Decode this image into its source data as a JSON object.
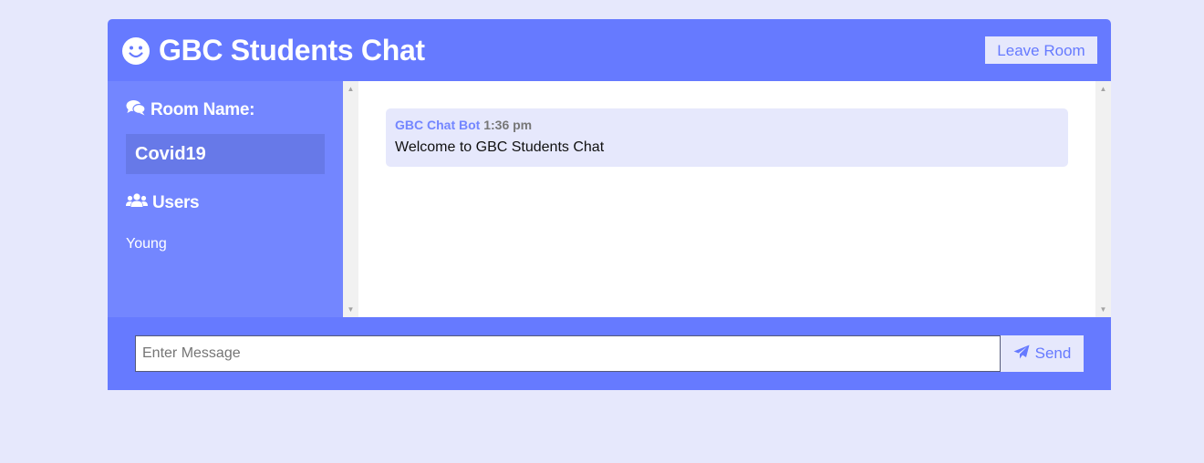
{
  "header": {
    "title": "GBC Students Chat",
    "leave_label": "Leave Room",
    "icon": "smile-icon"
  },
  "sidebar": {
    "room_heading": "Room Name:",
    "room_heading_icon": "comments-icon",
    "room_name": "Covid19",
    "users_heading": "Users",
    "users_heading_icon": "users-icon",
    "users": [
      "Young"
    ]
  },
  "messages": [
    {
      "username": "GBC Chat Bot",
      "time": "1:36 pm",
      "text": "Welcome to GBC Students Chat"
    }
  ],
  "form": {
    "placeholder": "Enter Message",
    "value": "",
    "send_label": "Send",
    "send_icon": "paper-plane-icon"
  },
  "colors": {
    "primary": "#667aff",
    "secondary": "#7386ff",
    "light": "#e6e8fc",
    "room_name_bg": "#6779e8"
  }
}
